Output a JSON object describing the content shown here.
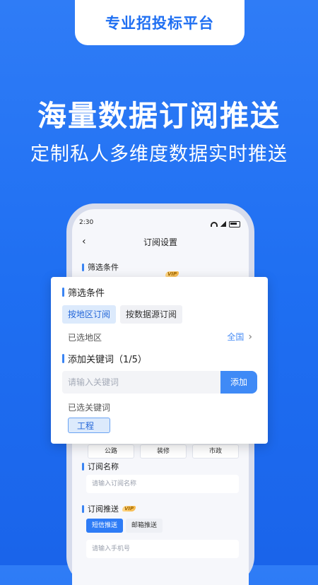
{
  "header": {
    "tab": "专业招投标平台",
    "headline": "海量数据订阅推送",
    "subline": "定制私人多维度数据实时推送"
  },
  "phone": {
    "status_time": "2:30",
    "title": "订阅设置",
    "back_icon": "chevron-left-icon",
    "filter_title": "筛选条件",
    "vip": "VIP",
    "industry_chips": [
      "公路",
      "装修",
      "市政"
    ],
    "name_title": "订阅名称",
    "name_placeholder": "请输入订阅名称",
    "push_title": "订阅推送",
    "push_sms": "短信推送",
    "push_email": "邮箱推送",
    "phone_placeholder": "请输入手机号"
  },
  "card": {
    "filter_title": "筛选条件",
    "by_region": "按地区订阅",
    "by_source": "按数据源订阅",
    "region_label": "已选地区",
    "region_value": "全国",
    "keyword_title": "添加关键词（1/5）",
    "keyword_placeholder": "请输入关键词",
    "add_button": "添加",
    "selected_label": "已选关键词",
    "selected_tags": [
      "工程"
    ]
  },
  "colors": {
    "brand_blue": "#1f6ff2",
    "accent_blue": "#3f8af6",
    "vip_gold": "#f6b84a"
  }
}
